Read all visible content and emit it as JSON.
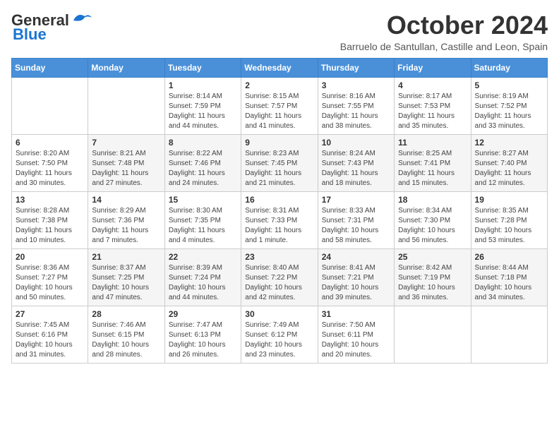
{
  "logo": {
    "line1": "General",
    "line2": "Blue"
  },
  "title": "October 2024",
  "subtitle": "Barruelo de Santullan, Castille and Leon, Spain",
  "weekdays": [
    "Sunday",
    "Monday",
    "Tuesday",
    "Wednesday",
    "Thursday",
    "Friday",
    "Saturday"
  ],
  "weeks": [
    [
      {
        "day": "",
        "info": ""
      },
      {
        "day": "",
        "info": ""
      },
      {
        "day": "1",
        "info": "Sunrise: 8:14 AM\nSunset: 7:59 PM\nDaylight: 11 hours and 44 minutes."
      },
      {
        "day": "2",
        "info": "Sunrise: 8:15 AM\nSunset: 7:57 PM\nDaylight: 11 hours and 41 minutes."
      },
      {
        "day": "3",
        "info": "Sunrise: 8:16 AM\nSunset: 7:55 PM\nDaylight: 11 hours and 38 minutes."
      },
      {
        "day": "4",
        "info": "Sunrise: 8:17 AM\nSunset: 7:53 PM\nDaylight: 11 hours and 35 minutes."
      },
      {
        "day": "5",
        "info": "Sunrise: 8:19 AM\nSunset: 7:52 PM\nDaylight: 11 hours and 33 minutes."
      }
    ],
    [
      {
        "day": "6",
        "info": "Sunrise: 8:20 AM\nSunset: 7:50 PM\nDaylight: 11 hours and 30 minutes."
      },
      {
        "day": "7",
        "info": "Sunrise: 8:21 AM\nSunset: 7:48 PM\nDaylight: 11 hours and 27 minutes."
      },
      {
        "day": "8",
        "info": "Sunrise: 8:22 AM\nSunset: 7:46 PM\nDaylight: 11 hours and 24 minutes."
      },
      {
        "day": "9",
        "info": "Sunrise: 8:23 AM\nSunset: 7:45 PM\nDaylight: 11 hours and 21 minutes."
      },
      {
        "day": "10",
        "info": "Sunrise: 8:24 AM\nSunset: 7:43 PM\nDaylight: 11 hours and 18 minutes."
      },
      {
        "day": "11",
        "info": "Sunrise: 8:25 AM\nSunset: 7:41 PM\nDaylight: 11 hours and 15 minutes."
      },
      {
        "day": "12",
        "info": "Sunrise: 8:27 AM\nSunset: 7:40 PM\nDaylight: 11 hours and 12 minutes."
      }
    ],
    [
      {
        "day": "13",
        "info": "Sunrise: 8:28 AM\nSunset: 7:38 PM\nDaylight: 11 hours and 10 minutes."
      },
      {
        "day": "14",
        "info": "Sunrise: 8:29 AM\nSunset: 7:36 PM\nDaylight: 11 hours and 7 minutes."
      },
      {
        "day": "15",
        "info": "Sunrise: 8:30 AM\nSunset: 7:35 PM\nDaylight: 11 hours and 4 minutes."
      },
      {
        "day": "16",
        "info": "Sunrise: 8:31 AM\nSunset: 7:33 PM\nDaylight: 11 hours and 1 minute."
      },
      {
        "day": "17",
        "info": "Sunrise: 8:33 AM\nSunset: 7:31 PM\nDaylight: 10 hours and 58 minutes."
      },
      {
        "day": "18",
        "info": "Sunrise: 8:34 AM\nSunset: 7:30 PM\nDaylight: 10 hours and 56 minutes."
      },
      {
        "day": "19",
        "info": "Sunrise: 8:35 AM\nSunset: 7:28 PM\nDaylight: 10 hours and 53 minutes."
      }
    ],
    [
      {
        "day": "20",
        "info": "Sunrise: 8:36 AM\nSunset: 7:27 PM\nDaylight: 10 hours and 50 minutes."
      },
      {
        "day": "21",
        "info": "Sunrise: 8:37 AM\nSunset: 7:25 PM\nDaylight: 10 hours and 47 minutes."
      },
      {
        "day": "22",
        "info": "Sunrise: 8:39 AM\nSunset: 7:24 PM\nDaylight: 10 hours and 44 minutes."
      },
      {
        "day": "23",
        "info": "Sunrise: 8:40 AM\nSunset: 7:22 PM\nDaylight: 10 hours and 42 minutes."
      },
      {
        "day": "24",
        "info": "Sunrise: 8:41 AM\nSunset: 7:21 PM\nDaylight: 10 hours and 39 minutes."
      },
      {
        "day": "25",
        "info": "Sunrise: 8:42 AM\nSunset: 7:19 PM\nDaylight: 10 hours and 36 minutes."
      },
      {
        "day": "26",
        "info": "Sunrise: 8:44 AM\nSunset: 7:18 PM\nDaylight: 10 hours and 34 minutes."
      }
    ],
    [
      {
        "day": "27",
        "info": "Sunrise: 7:45 AM\nSunset: 6:16 PM\nDaylight: 10 hours and 31 minutes."
      },
      {
        "day": "28",
        "info": "Sunrise: 7:46 AM\nSunset: 6:15 PM\nDaylight: 10 hours and 28 minutes."
      },
      {
        "day": "29",
        "info": "Sunrise: 7:47 AM\nSunset: 6:13 PM\nDaylight: 10 hours and 26 minutes."
      },
      {
        "day": "30",
        "info": "Sunrise: 7:49 AM\nSunset: 6:12 PM\nDaylight: 10 hours and 23 minutes."
      },
      {
        "day": "31",
        "info": "Sunrise: 7:50 AM\nSunset: 6:11 PM\nDaylight: 10 hours and 20 minutes."
      },
      {
        "day": "",
        "info": ""
      },
      {
        "day": "",
        "info": ""
      }
    ]
  ]
}
